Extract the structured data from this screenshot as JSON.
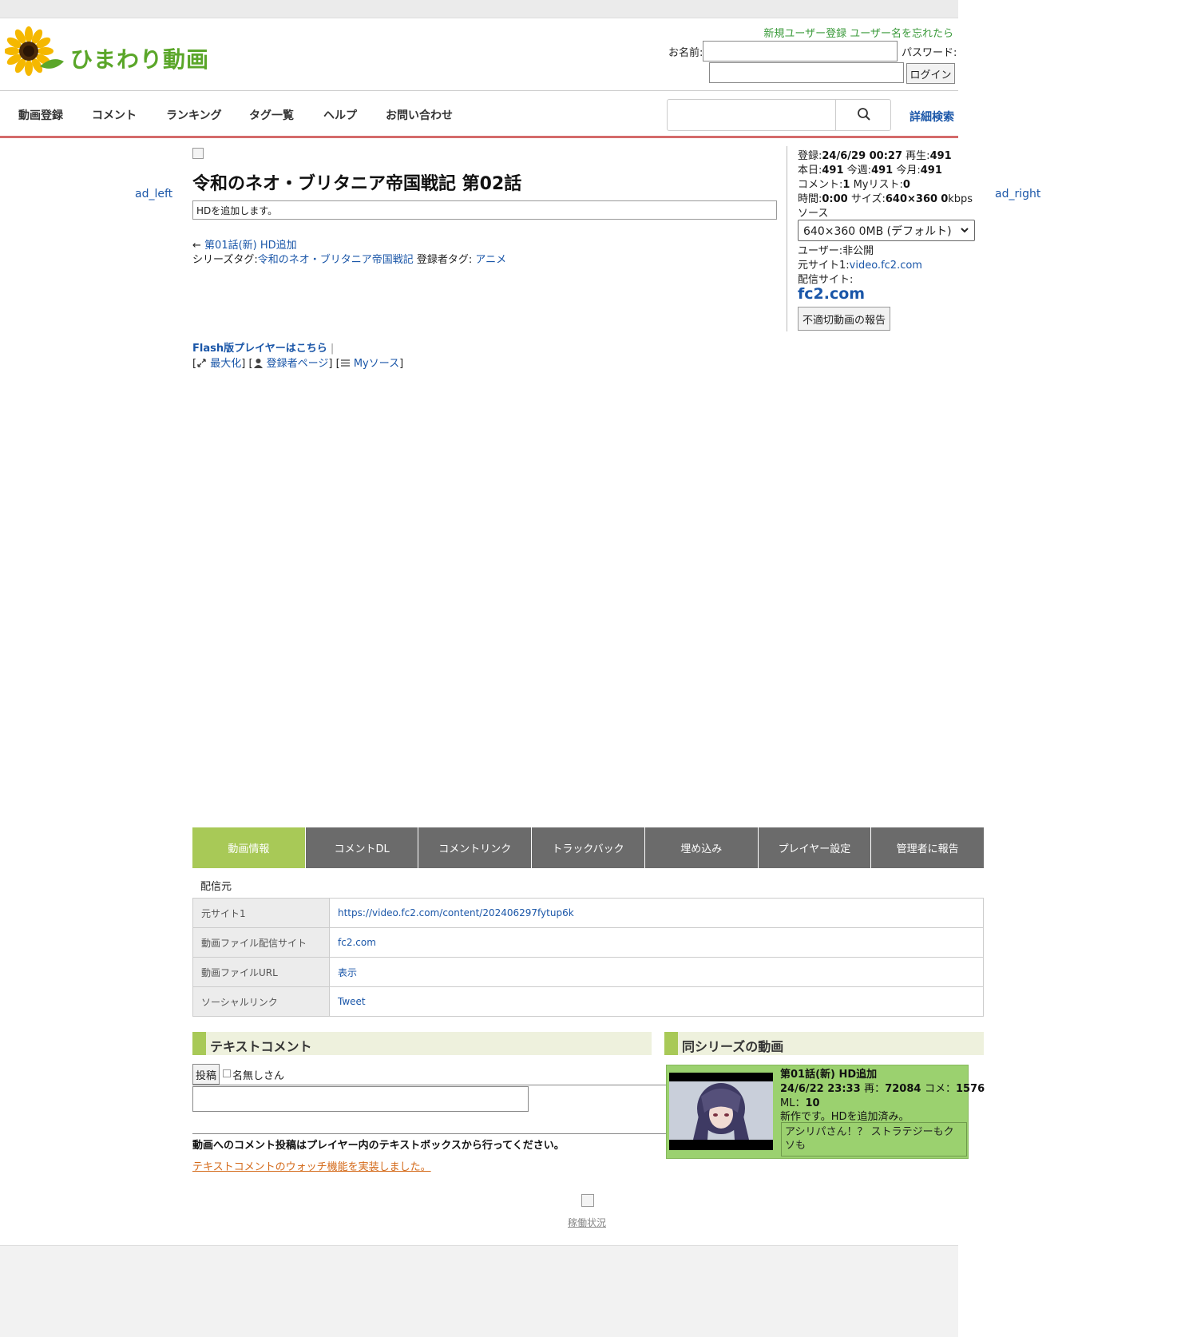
{
  "site": {
    "logo_text": "ひまわり動画"
  },
  "header": {
    "register_link": "新規ユーザー登録",
    "forgot_link": "ユーザー名を忘れたら",
    "name_label": "お名前:",
    "password_label": "パスワード:",
    "login_button": "ログイン"
  },
  "nav": {
    "items": [
      "動画登録",
      "コメント",
      "ランキング",
      "タグ一覧",
      "ヘルプ",
      "お問い合わせ"
    ],
    "search_placeholder": "",
    "advanced_search": "詳細検索"
  },
  "ads": {
    "left": "ad_left",
    "right": "ad_right"
  },
  "video": {
    "title": "令和のネオ・ブリタニア帝国戦記 第02話",
    "description": "HDを追加します。",
    "prev_arrow": "←",
    "prev_link": "第01話(新) HD追加",
    "series_tag_label": "シリーズタグ:",
    "series_tag": "令和のネオ・ブリタニア帝国戦記",
    "uploader_tag_label": "登録者タグ:",
    "uploader_tag": "アニメ",
    "flash_link": "Flash版プレイヤーはこちら",
    "flash_sep": "|",
    "maximize": "最大化",
    "uploader_page": "登録者ページ",
    "my_source": "Myソース"
  },
  "side": {
    "registered_label": "登録:",
    "registered": "24/6/29 00:27",
    "plays_label": "再生:",
    "plays": "491",
    "today_label": "本日:",
    "today": "491",
    "week_label": "今週:",
    "week": "491",
    "month_label": "今月:",
    "month": "491",
    "comments_label": "コメント:",
    "comments": "1",
    "mylist_label": "Myリスト:",
    "mylist": "0",
    "time_label": "時間:",
    "time": "0:00",
    "size_label": "サイズ:",
    "size": "640×360",
    "bitrate": "0",
    "bitrate_unit": "kbps",
    "source_label": "ソース",
    "source_selected": "640×360 0MB (デフォルト)",
    "user_label": "ユーザー:",
    "user": "非公開",
    "origin_label": "元サイト1:",
    "origin": "video.fc2.com",
    "delivery_label": "配信サイト:",
    "delivery": "fc2.com",
    "report_button": "不適切動画の報告"
  },
  "tabs": [
    "動画情報",
    "コメントDL",
    "コメントリンク",
    "トラックバック",
    "埋め込み",
    "プレイヤー設定",
    "管理者に報告"
  ],
  "distribution": {
    "label": "配信元",
    "rows": [
      {
        "key": "元サイト1",
        "value": "https://video.fc2.com/content/202406297fytup6k"
      },
      {
        "key": "動画ファイル配信サイト",
        "value": "fc2.com"
      },
      {
        "key": "動画ファイルURL",
        "value": "表示"
      },
      {
        "key": "ソーシャルリンク",
        "value": "Tweet"
      }
    ]
  },
  "text_comment": {
    "title": "テキストコメント",
    "post_button": "投稿",
    "anonymous": "名無しさん",
    "note": "動画へのコメント投稿はプレイヤー内のテキストボックスから行ってください。",
    "watch_link": "テキストコメントのウォッチ機能を実装しました。"
  },
  "series": {
    "title": "同シリーズの動画",
    "items": [
      {
        "title": "第01話(新) HD追加",
        "date": "24/6/22 23:33",
        "plays_label": "再：",
        "plays": "72084",
        "comments_label": "コメ：",
        "comments": "1576",
        "ml_label": "ML：",
        "ml": "10",
        "desc": "新作です。HDを追加済み。",
        "comment": "アシリパさん！？ ストラテジーもクソも"
      }
    ]
  },
  "footer": {
    "status_link": "稼働状況"
  },
  "colors": {
    "accent_green": "#a8c957",
    "link_blue": "#1a56a8",
    "nav_underline": "#d46b6b",
    "card_green": "#9bd16f"
  }
}
